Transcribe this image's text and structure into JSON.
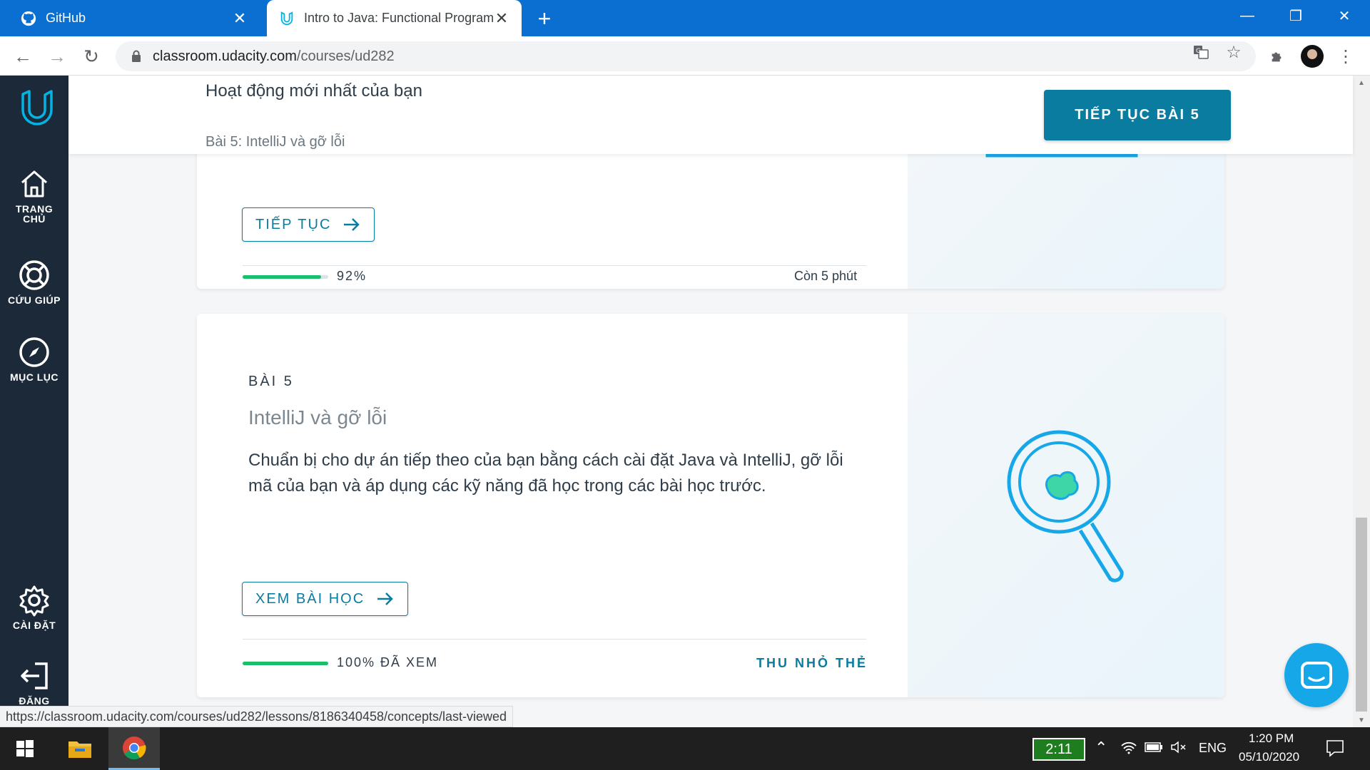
{
  "browser": {
    "tabs": [
      {
        "title": "GitHub",
        "icon": "github-icon"
      },
      {
        "title": "Intro to Java: Functional Program",
        "icon": "udacity-icon"
      }
    ],
    "url_domain": "classroom.udacity.com",
    "url_path": "/courses/ud282"
  },
  "sidebar": {
    "items": [
      {
        "label": "TRANG CHỦ",
        "icon": "home-icon"
      },
      {
        "label": "CỨU GIÚP",
        "icon": "lifebuoy-icon"
      },
      {
        "label": "MỤC LỤC",
        "icon": "compass-icon"
      },
      {
        "label": "CÀI ĐẶT",
        "icon": "gear-icon"
      },
      {
        "label": "ĐĂNG",
        "icon": "logout-icon"
      }
    ]
  },
  "topbar": {
    "heading": "Hoạt động mới nhất của bạn",
    "subheading": "Bài 5: IntelliJ và gỡ lỗi",
    "resume_button": "TIẾP TỤC BÀI 5"
  },
  "card1": {
    "continue_button": "TIẾP TỤC",
    "progress_percent": 92,
    "progress_text": "92%",
    "time_left": "Còn 5 phút"
  },
  "card2": {
    "lesson_number": "BÀI 5",
    "title": "IntelliJ và gỡ lỗi",
    "description": "Chuẩn bị cho dự án tiếp theo của bạn bằng cách cài đặt Java và IntelliJ, gỡ lỗi mã của bạn và áp dụng các kỹ năng đã học trong các bài học trước.",
    "view_button": "XEM BÀI HỌC",
    "progress_percent": 100,
    "progress_text": "100% ĐÃ XEM",
    "collapse_link": "THU NHỎ THẺ"
  },
  "status_url": "https://classroom.udacity.com/courses/ud282/lessons/8186340458/concepts/last-viewed",
  "taskbar": {
    "battery_timer": "2:11",
    "language": "ENG",
    "time": "1:20 PM",
    "date": "05/10/2020"
  },
  "colors": {
    "accent": "#0a7ca0",
    "progress": "#1bbf6b",
    "sidebar": "#1b2938",
    "chrome": "#0b6fd1"
  }
}
